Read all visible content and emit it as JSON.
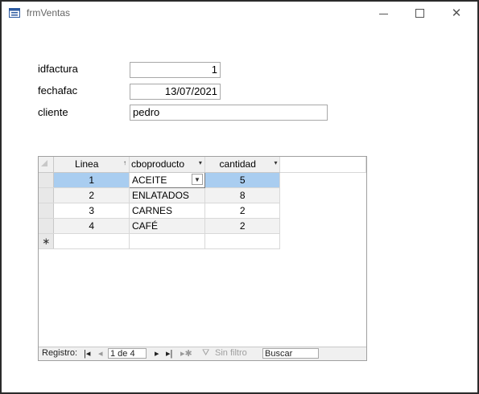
{
  "window": {
    "title": "frmVentas"
  },
  "form": {
    "idfactura": {
      "label": "idfactura",
      "value": "1"
    },
    "fechafac": {
      "label": "fechafac",
      "value": "13/07/2021"
    },
    "cliente": {
      "label": "cliente",
      "value": "pedro"
    }
  },
  "subform": {
    "columns": [
      {
        "label": "Linea",
        "arrow": "↑"
      },
      {
        "label": "cboproducto",
        "arrow": "▾"
      },
      {
        "label": "cantidad",
        "arrow": "▾"
      }
    ],
    "rows": [
      {
        "linea": "1",
        "producto": "ACEITE",
        "cantidad": "5"
      },
      {
        "linea": "2",
        "producto": "ENLATADOS",
        "cantidad": "8"
      },
      {
        "linea": "3",
        "producto": "CARNES",
        "cantidad": "2"
      },
      {
        "linea": "4",
        "producto": "CAFÉ",
        "cantidad": "2"
      }
    ],
    "new_row_marker": "∗"
  },
  "navigation": {
    "record_label": "Registro:",
    "position": "1 de 4",
    "filter_label": "Sin filtro",
    "search_label": "Buscar"
  },
  "colors": {
    "selection": "#a9cdf0",
    "border": "#2b2b2b"
  }
}
